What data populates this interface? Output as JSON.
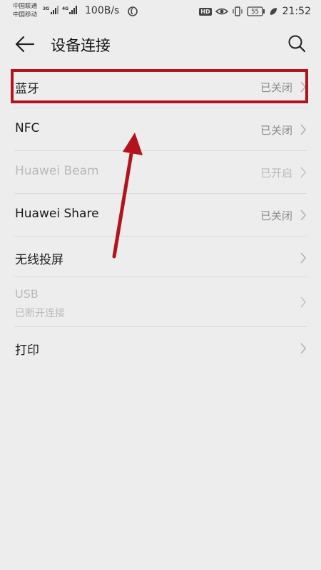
{
  "status_bar": {
    "carrier_1": "中国联通",
    "carrier_2": "中国移动",
    "net_1": "3G",
    "net_2": "4G",
    "speed": "100B/s",
    "hd": "HD",
    "battery": "55",
    "time": "21:52"
  },
  "app_bar": {
    "title": "设备连接"
  },
  "items": [
    {
      "label": "蓝牙",
      "value": "已关闭",
      "disabled": false
    },
    {
      "label": "NFC",
      "value": "已关闭",
      "disabled": false
    },
    {
      "label": "Huawei Beam",
      "value": "已开启",
      "disabled": true
    },
    {
      "label": "Huawei Share",
      "value": "已关闭",
      "disabled": false
    },
    {
      "label": "无线投屏",
      "value": "",
      "disabled": false
    },
    {
      "label": "USB",
      "sublabel": "已断开连接",
      "disabled": true
    },
    {
      "label": "打印",
      "value": "",
      "disabled": false
    }
  ],
  "colors": {
    "background": "#ededed",
    "annotation_red": "#b3141c",
    "secondary_text": "#8a8a8a",
    "disabled_text": "#b9b9b9"
  }
}
